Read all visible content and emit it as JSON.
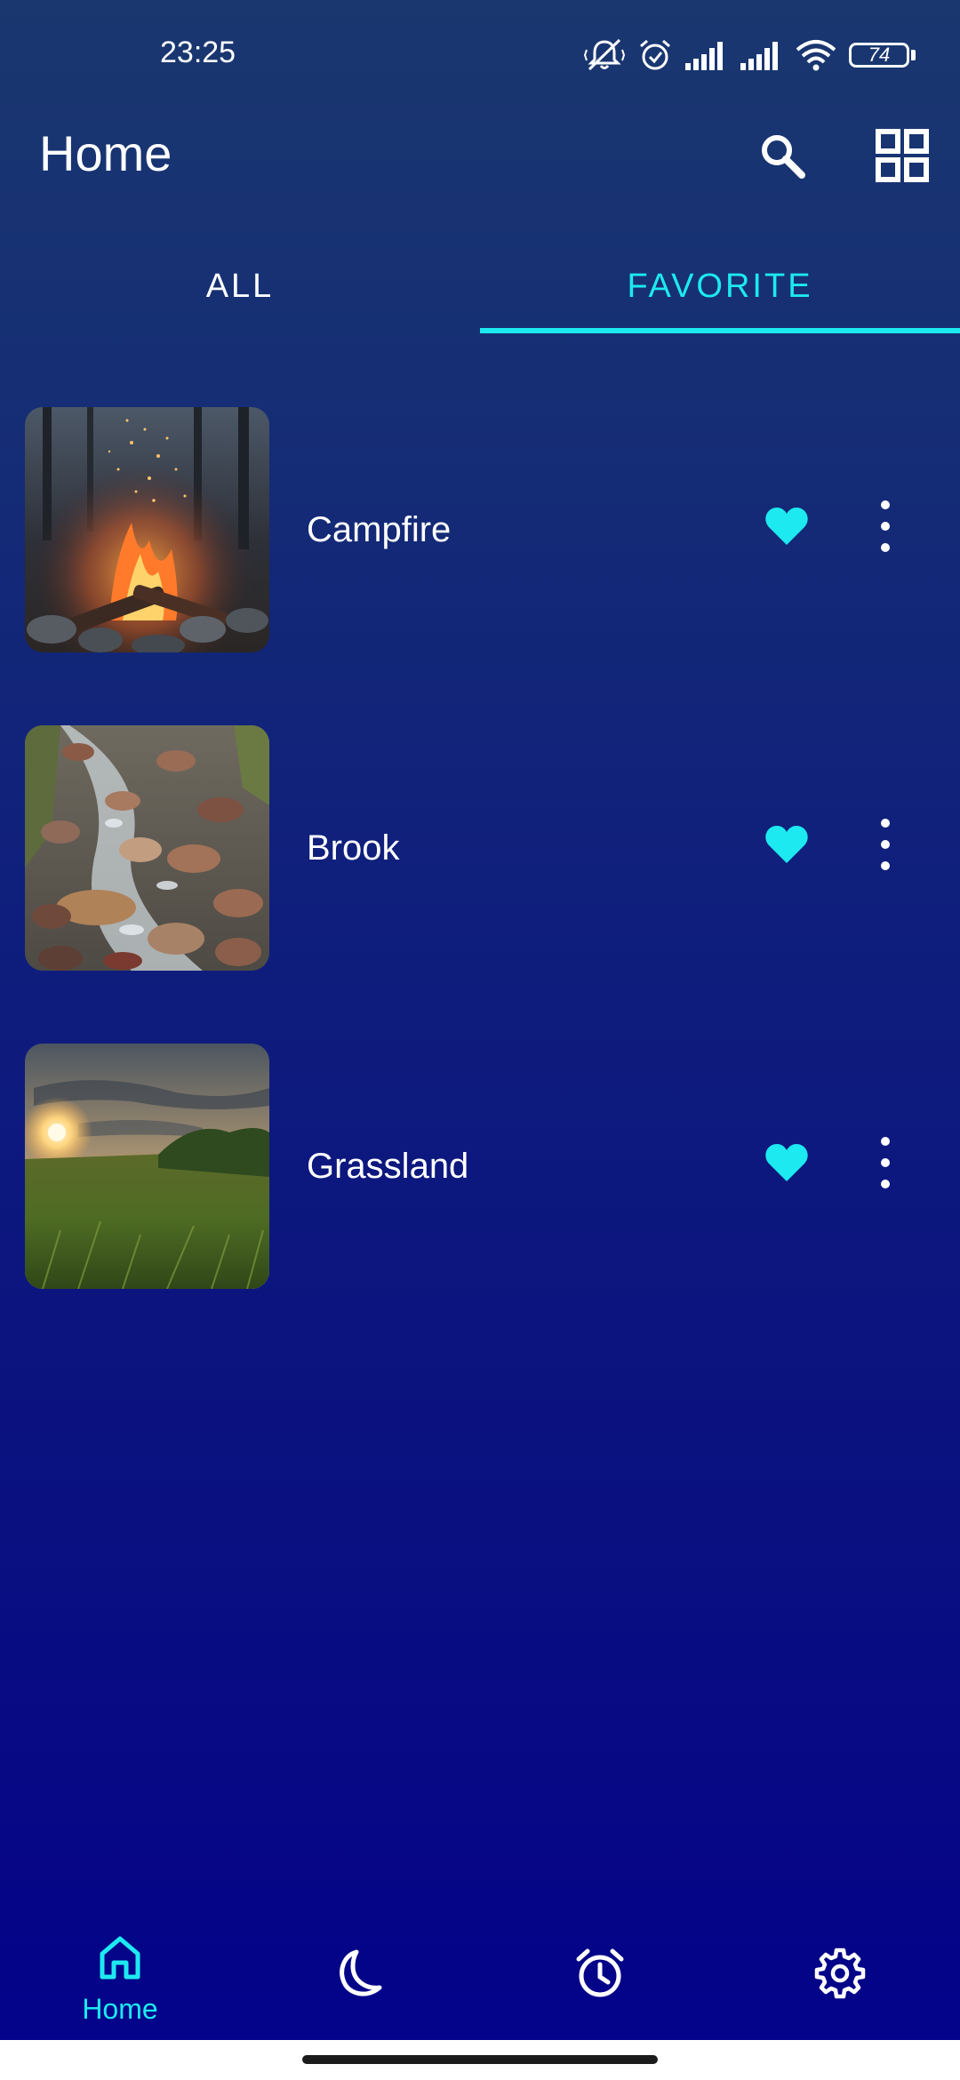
{
  "status_bar": {
    "time": "23:25",
    "battery_level": "74",
    "icons": [
      "mute-vibrate-icon",
      "alarm-icon",
      "signal-icon",
      "signal-icon",
      "wifi-icon",
      "battery-icon"
    ]
  },
  "app_bar": {
    "title": "Home",
    "actions": [
      "search-icon",
      "grid-view-icon"
    ]
  },
  "tabs": [
    {
      "label": "ALL",
      "active": false
    },
    {
      "label": "FAVORITE",
      "active": true
    }
  ],
  "sounds": [
    {
      "name": "Campfire",
      "favorite": true,
      "thumbnail": "campfire"
    },
    {
      "name": "Brook",
      "favorite": true,
      "thumbnail": "brook"
    },
    {
      "name": "Grassland",
      "favorite": true,
      "thumbnail": "grassland"
    }
  ],
  "bottom_nav": {
    "items": [
      {
        "icon": "home-icon",
        "label": "Home",
        "active": true
      },
      {
        "icon": "moon-icon",
        "label": "",
        "active": false
      },
      {
        "icon": "alarm-clock-icon",
        "label": "",
        "active": false
      },
      {
        "icon": "gear-icon",
        "label": "",
        "active": false
      }
    ]
  },
  "colors": {
    "accent": "#1de9f0",
    "text": "#ffffff",
    "background_top": "#1a376f",
    "background_bottom": "#03038b"
  }
}
